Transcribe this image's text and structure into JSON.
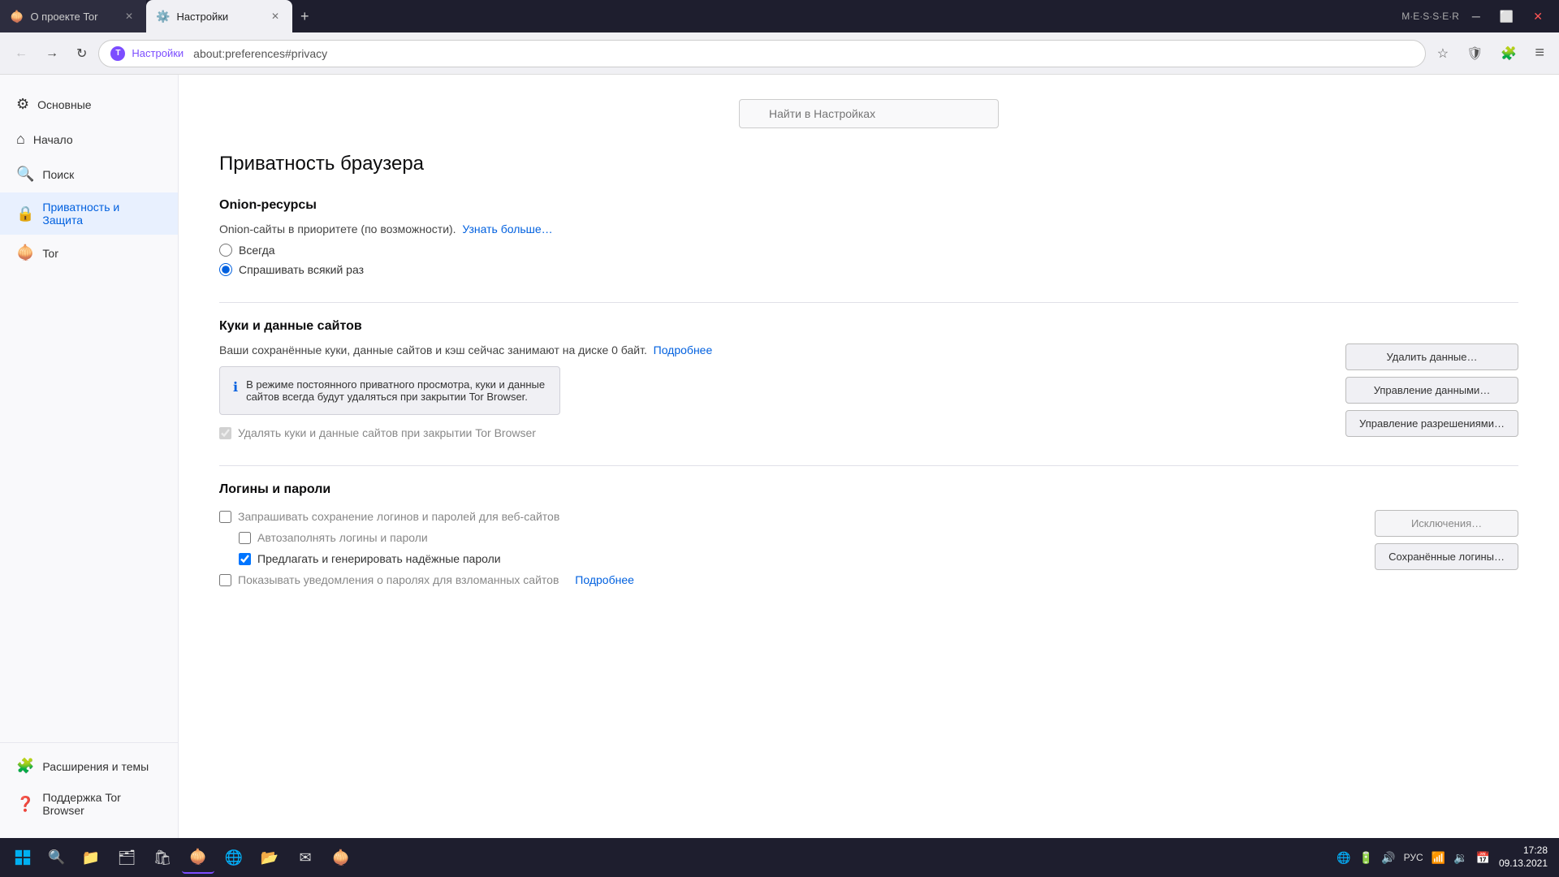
{
  "browser": {
    "tabs": [
      {
        "id": "tab1",
        "icon": "🧅",
        "label": "О проекте Tor",
        "active": false
      },
      {
        "id": "tab2",
        "icon": "⚙️",
        "label": "Настройки",
        "active": true
      }
    ],
    "add_tab_label": "+",
    "window_title": "M·E·S·S·E·R",
    "address": "about:preferences#privacy",
    "tor_logo": "T"
  },
  "nav": {
    "back_label": "←",
    "forward_label": "→",
    "reload_label": "↻",
    "bookmark_label": "☆",
    "shield_label": "🛡",
    "extensions_label": "🧩",
    "more_label": "≡"
  },
  "search": {
    "placeholder": "Найти в Настройках"
  },
  "page": {
    "title": "Приватность браузера"
  },
  "sidebar": {
    "items": [
      {
        "id": "general",
        "icon": "⚙",
        "label": "Основные",
        "active": false
      },
      {
        "id": "home",
        "icon": "⌂",
        "label": "Начало",
        "active": false
      },
      {
        "id": "search",
        "icon": "🔍",
        "label": "Поиск",
        "active": false
      },
      {
        "id": "privacy",
        "icon": "🔒",
        "label": "Приватность и Защита",
        "active": true
      },
      {
        "id": "tor",
        "icon": "🧅",
        "label": "Tor",
        "active": false
      }
    ],
    "bottom_items": [
      {
        "id": "extensions",
        "icon": "🧩",
        "label": "Расширения и темы",
        "active": false
      },
      {
        "id": "support",
        "icon": "❓",
        "label": "Поддержка Tor Browser",
        "active": false
      }
    ]
  },
  "sections": {
    "onion": {
      "title": "Onion-ресурсы",
      "desc": "Onion-сайты в приоритете (по возможности).",
      "learn_more": "Узнать больше…",
      "options": [
        {
          "id": "always",
          "label": "Всегда",
          "checked": false
        },
        {
          "id": "ask",
          "label": "Спрашивать всякий раз",
          "checked": true
        }
      ]
    },
    "cookies": {
      "title": "Куки и данные сайтов",
      "desc": "Ваши сохранённые куки, данные сайтов и кэш сейчас занимают на диске 0 байт.",
      "more_link": "Подробнее",
      "info_text": "В режиме постоянного приватного просмотра, куки и данные сайтов всегда будут удаляться при закрытии Tor Browser.",
      "delete_checkbox": "Удалять куки и данные сайтов при закрытии Tor Browser",
      "buttons": [
        {
          "id": "delete-data",
          "label": "Удалить данные…"
        },
        {
          "id": "manage-data",
          "label": "Управление данными…"
        },
        {
          "id": "manage-perms",
          "label": "Управление разрешениями…"
        }
      ]
    },
    "logins": {
      "title": "Логины и пароли",
      "checkboxes": [
        {
          "id": "ask-save",
          "label": "Запрашивать сохранение логинов и паролей для веб-сайтов",
          "checked": false
        },
        {
          "id": "autofill",
          "label": "Автозаполнять логины и пароли",
          "checked": false
        },
        {
          "id": "suggest-pwd",
          "label": "Предлагать и генерировать надёжные пароли",
          "checked": true
        },
        {
          "id": "show-notif",
          "label": "Показывать уведомления о паролях для взломанных сайтов",
          "checked": false
        }
      ],
      "more_link": "Подробнее",
      "buttons": [
        {
          "id": "exceptions",
          "label": "Исключения…"
        },
        {
          "id": "saved-logins",
          "label": "Сохранённые логины…"
        }
      ]
    }
  },
  "taskbar": {
    "time": "17:28",
    "date": "09.13.2021",
    "lang": "РУС",
    "icons": [
      "🔋",
      "📶",
      "🔊",
      "📅"
    ]
  }
}
